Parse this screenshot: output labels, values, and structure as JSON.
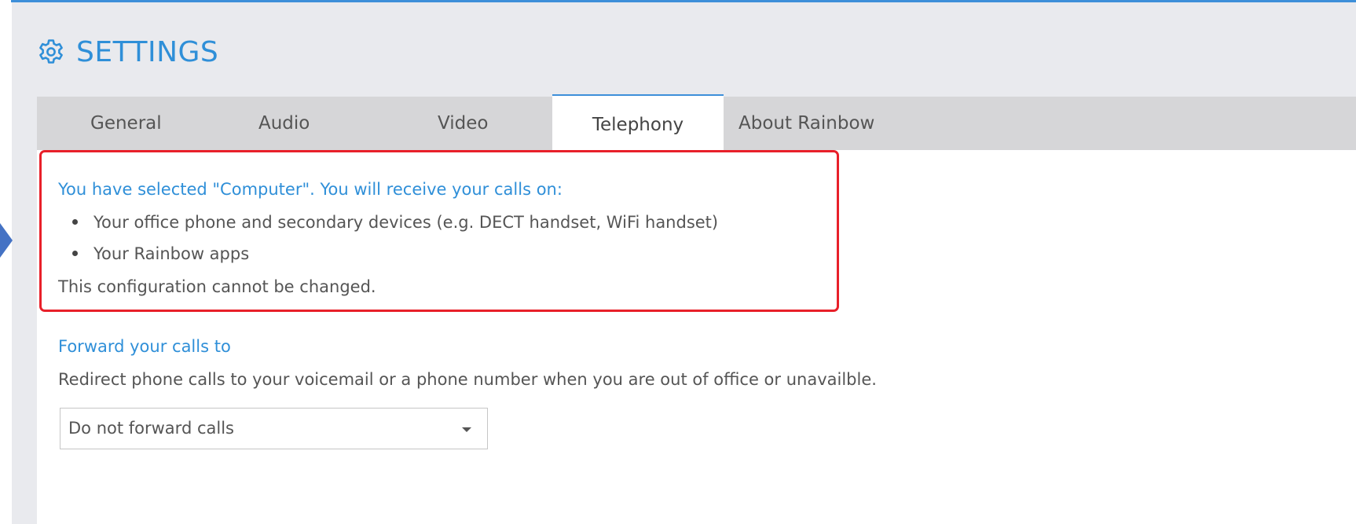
{
  "header": {
    "title": "SETTINGS",
    "icon": "gear-icon"
  },
  "tabs": [
    {
      "label": "General",
      "active": false
    },
    {
      "label": "Audio",
      "active": false
    },
    {
      "label": "Video",
      "active": false
    },
    {
      "label": "Telephony",
      "active": true
    },
    {
      "label": "About Rainbow",
      "active": false
    }
  ],
  "info": {
    "heading": "You have selected \"Computer\". You will receive your calls on:",
    "items": [
      "Your office phone and secondary devices (e.g. DECT handset, WiFi handset)",
      "Your Rainbow apps"
    ],
    "note": "This configuration cannot be changed."
  },
  "forward": {
    "heading": "Forward your calls to",
    "description": "Redirect phone calls to your voicemail or a phone number when you are out of office or unavailble.",
    "select_value": "Do not forward calls"
  },
  "colors": {
    "accent": "#2f8fd8",
    "highlight_border": "#e8202a",
    "callout_arrow": "#4472c4",
    "panel_bg": "#e9eaee",
    "tabbar_bg": "#d6d6d8"
  }
}
